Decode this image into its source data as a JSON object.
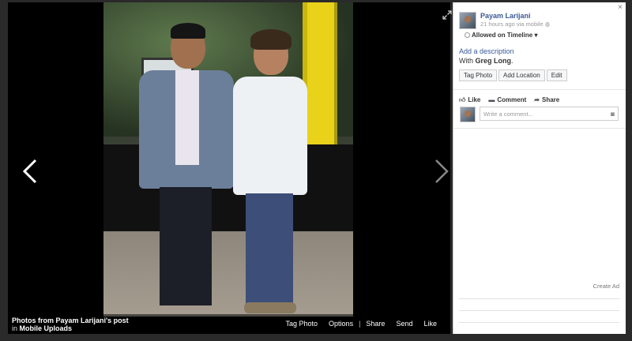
{
  "photo_viewer": {
    "caption_title": "Photos from Payam Larijani's post",
    "caption_in": "in",
    "caption_album": "Mobile Uploads",
    "actions": [
      "Tag Photo",
      "Options",
      "Share",
      "Send",
      "Like"
    ],
    "prev_icon": "chevron-left-icon",
    "next_icon": "chevron-right-icon",
    "expand_icon": "expand-icon"
  },
  "panel": {
    "close_label": "×",
    "author": "Payam Larijani",
    "meta": "21 hours ago via mobile",
    "timeline": "Allowed on Timeline",
    "add_description": "Add a description",
    "with_prefix": "With",
    "tagged_person": "Greg Long",
    "buttons": [
      "Tag Photo",
      "Add Location",
      "Edit"
    ],
    "social": [
      "Like",
      "Comment",
      "Share"
    ],
    "comment_placeholder": "Write a comment...",
    "create_ad": "Create Ad"
  },
  "colors": {
    "link": "#3b5998",
    "viewer_bg": "#000000",
    "page_bg": "#2a2a2a"
  }
}
